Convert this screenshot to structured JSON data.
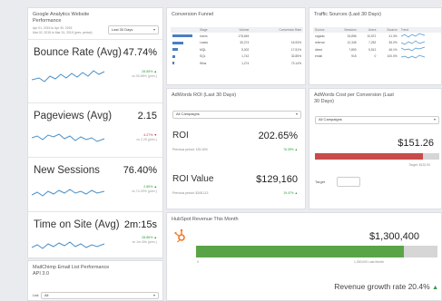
{
  "analytics": {
    "title": "Google Analytics Website Performance",
    "date_range": "Apr 01, 2015 to Apr 30, 2015",
    "compare_range": "Mar 02, 2015 to Mar 31, 2015 (prev. period)",
    "period_select": "Last 30 Days",
    "metrics": [
      {
        "label": "Bounce Rate (Avg)",
        "value": "47.74%",
        "delta": "28.85% ▲",
        "compare": "vs 35.88% (prev.)",
        "negative": false
      },
      {
        "label": "Pageviews (Avg)",
        "value": "2.15",
        "delta": "4.27% ▼",
        "compare": "vs 2.25 (prev.)",
        "negative": true
      },
      {
        "label": "New Sessions",
        "value": "76.40%",
        "delta": "2.85% ▲",
        "compare": "vs 74.29% (prev.)",
        "negative": false
      },
      {
        "label": "Time on Site (Avg)",
        "value": "2m:15s",
        "delta": "28.86% ▲",
        "compare": "vs 1m:45s (prev.)",
        "negative": false
      }
    ]
  },
  "mailchimp": {
    "title": "MailChimp Email List Performance",
    "subtitle": "API 3.0",
    "list_label": "List:",
    "list_value": "All"
  },
  "funnel": {
    "title": "Conversion Funnel",
    "headers": [
      "",
      "Stage",
      "Volume",
      "Conversion Rate"
    ],
    "rows": [
      {
        "stage": "Users",
        "volume": "178,845",
        "rate": "",
        "bar": 1.0
      },
      {
        "stage": "Leads",
        "volume": "30,274",
        "rate": "16.93%",
        "bar": 0.55
      },
      {
        "stage": "MQL",
        "volume": "5,302",
        "rate": "17.51%",
        "bar": 0.25
      },
      {
        "stage": "SQL",
        "volume": "1,742",
        "rate": "32.85%",
        "bar": 0.12
      },
      {
        "stage": "Wins",
        "volume": "1,274",
        "rate": "73.14%",
        "bar": 0.08
      }
    ]
  },
  "traffic": {
    "title": "Traffic Sources (Last 30 Days)",
    "headers": [
      "Source",
      "Sessions",
      "Users",
      "Bounce",
      "Trend"
    ],
    "rows": [
      {
        "source": "organic",
        "sessions": "15,896",
        "users": "10,572",
        "bounce": "41.3%"
      },
      {
        "source": "referral",
        "sessions": "12,345",
        "users": "7,252",
        "bounce": "35.2%"
      },
      {
        "source": "direct",
        "sessions": "7,890",
        "users": "5,512",
        "bounce": "46.1%"
      },
      {
        "source": "email",
        "sessions": "915",
        "users": "0",
        "bounce": "100.0%"
      }
    ]
  },
  "adwords_roi": {
    "title": "AdWords ROI (Last 30 Days)",
    "campaign_select": "All Campaigns",
    "roi_label": "ROI",
    "roi_value": "202.65%",
    "roi_prev": "Previous period: 125.16%",
    "roi_delta": "76.39% ▲",
    "value_label": "ROI Value",
    "value_value": "$129,160",
    "value_prev": "Previous period: $108,113",
    "value_delta": "19.47% ▲"
  },
  "adwords_cost": {
    "title": "AdWords Cost per Conversion (Last 30 Days)",
    "campaign_select": "All Campaigns",
    "value": "$151.26",
    "target_caption": "Target: $132.00",
    "target_label": "Target",
    "progress": 0.87
  },
  "hubspot": {
    "title": "HubSpot Revenue This Month",
    "revenue": "$1,300,400",
    "axis_start": "0",
    "axis_mid": "1,300,000 Last Month",
    "growth_label": "Revenue growth rate",
    "growth_value": "20.4%",
    "progress": 0.86,
    "colors": {
      "accent": "#f57722",
      "bar": "#5aa448",
      "track": "#d6d6d6",
      "positive": "#2e9b3a"
    }
  }
}
